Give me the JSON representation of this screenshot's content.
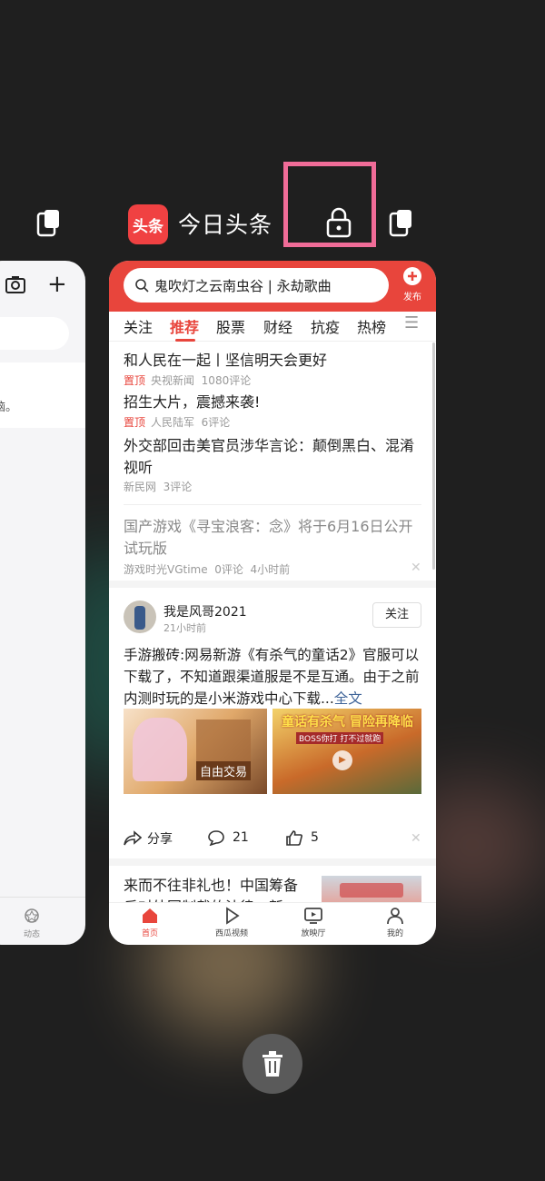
{
  "app": {
    "title": "今日头条",
    "logo_text": "头条"
  },
  "icons": {
    "lock": "lock-icon",
    "split": "split-screen-icon",
    "trash": "trash-icon"
  },
  "left_card": {
    "partial_text": "电脑。",
    "bottom_label": "动态"
  },
  "search": {
    "query": "鬼吹灯之云南虫谷 | 永劫歌曲",
    "publish_label": "发布"
  },
  "tabs": [
    "关注",
    "推荐",
    "股票",
    "财经",
    "抗疫",
    "热榜"
  ],
  "active_tab": "推荐",
  "news": [
    {
      "title": "和人民在一起丨坚信明天会更好",
      "pin": "置顶",
      "source": "央视新闻",
      "comments": "1080评论"
    },
    {
      "title": "招生大片，震撼来袭!",
      "pin": "置顶",
      "source": "人民陆军",
      "comments": "6评论"
    },
    {
      "title": "外交部回击美官员涉华言论：颠倒黑白、混淆视听",
      "source": "新民网",
      "comments": "3评论"
    },
    {
      "title": "国产游戏《寻宝浪客：念》将于6月16日公开试玩版",
      "source": "游戏时光VGtime",
      "comments": "0评论",
      "time": "4小时前"
    }
  ],
  "post": {
    "author": "我是风哥2021",
    "time": "21小时前",
    "follow_label": "关注",
    "text": "手游搬砖:网易新游《有杀气的童话2》官服可以下载了，不知道跟渠道服是不是互通。由于之前内测时玩的是小米游戏中心下载...",
    "more": "全文",
    "image1_caption": "自由交易",
    "image2_caption": "童话有杀气 冒险再降临",
    "image2_sub": "BOSS你打 打不过就跑",
    "share_label": "分享",
    "comment_count": "21",
    "like_count": "5"
  },
  "partial_news": {
    "title": "来而不往非礼也！中国筹备反对外国制裁的法律，新法..."
  },
  "bottom_nav": [
    "首页",
    "西瓜视频",
    "放映厅",
    "我的"
  ],
  "colors": {
    "accent": "#e8453c",
    "lock_highlight": "#f06c98"
  }
}
